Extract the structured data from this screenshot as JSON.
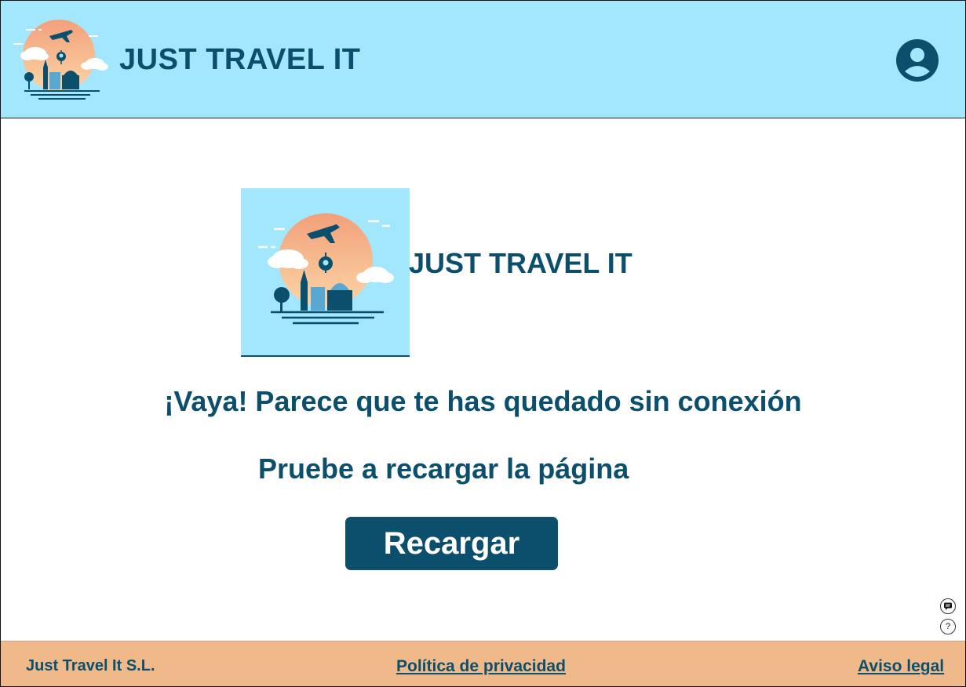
{
  "header": {
    "title": "JUST TRAVEL IT",
    "logo_icon": "travel-logo-icon",
    "user_icon": "user-account-icon"
  },
  "main": {
    "brand_title": "JUST TRAVEL IT",
    "message_primary": "¡Vaya! Parece que te has quedado sin conexión",
    "message_secondary": "Pruebe a recargar la página",
    "reload_button_label": "Recargar"
  },
  "floating": {
    "chat_icon": "chat-icon",
    "help_icon": "help-icon",
    "help_glyph": "?"
  },
  "footer": {
    "company": "Just Travel It S.L.",
    "privacy_link": "Política de privacidad",
    "legal_link": "Aviso legal"
  },
  "colors": {
    "header_bg": "#a2e7fd",
    "brand_navy": "#0b4f6c",
    "footer_bg": "#f0b98a",
    "sun_orange": "#f5b07c"
  }
}
